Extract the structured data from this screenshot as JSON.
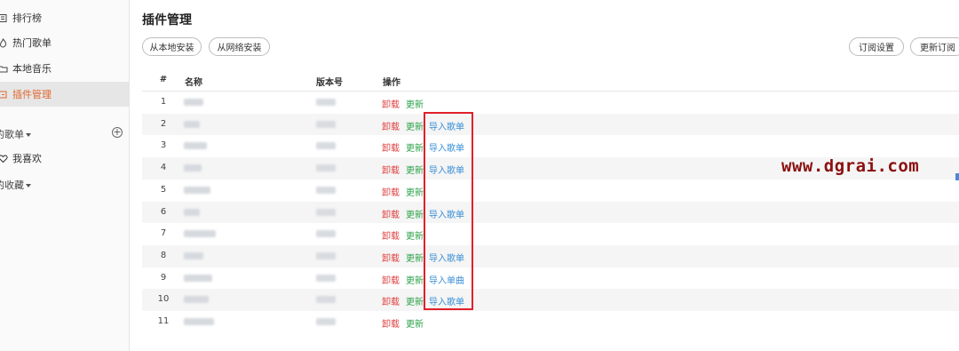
{
  "sidebar": {
    "items": [
      {
        "label": "排行榜",
        "icon": "chart-icon"
      },
      {
        "label": "热门歌单",
        "icon": "fire-icon"
      },
      {
        "label": "本地音乐",
        "icon": "folder-icon"
      },
      {
        "label": "插件管理",
        "icon": "plugin-icon",
        "active": true
      }
    ],
    "my_playlists": "的歌单",
    "favorites": "我喜欢",
    "my_collections": "的收藏"
  },
  "main": {
    "title": "插件管理",
    "buttons": {
      "install_local": "从本地安装",
      "install_network": "从网络安装",
      "subscription_settings": "订阅设置",
      "update_subscription": "更新订阅"
    },
    "table": {
      "headers": {
        "num": "#",
        "name": "名称",
        "version": "版本号",
        "ops": "操作"
      },
      "ops_labels": {
        "uninstall": "卸载",
        "update": "更新"
      },
      "rows": [
        {
          "num": "1",
          "import": ""
        },
        {
          "num": "2",
          "import": "导入歌单"
        },
        {
          "num": "3",
          "import": "导入歌单"
        },
        {
          "num": "4",
          "import": "导入歌单"
        },
        {
          "num": "5",
          "import": ""
        },
        {
          "num": "6",
          "import": "导入歌单"
        },
        {
          "num": "7",
          "import": ""
        },
        {
          "num": "8",
          "import": "导入歌单"
        },
        {
          "num": "9",
          "import": "导入单曲"
        },
        {
          "num": "10",
          "import": "导入歌单"
        },
        {
          "num": "11",
          "import": ""
        }
      ]
    }
  },
  "watermark": "www.dgrai.com",
  "colors": {
    "accent": "#e0662f",
    "uninstall": "#e04040",
    "update": "#2da24a",
    "import": "#3a8fd6",
    "highlight": "#e0202a",
    "watermark": "#8b1010"
  }
}
